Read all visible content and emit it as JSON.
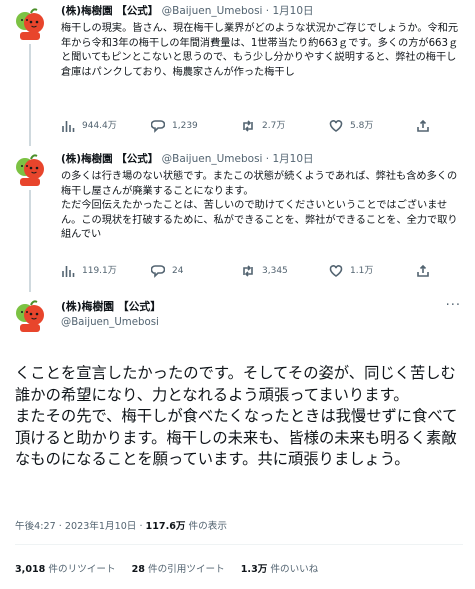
{
  "account": {
    "name": "(株)梅樹園 【公式】",
    "handle": "@Baijuen_Umebosi"
  },
  "tweets": [
    {
      "name": "(株)梅樹園 【公式】",
      "handle_date": "@Baijuen_Umebosi · 1月10日",
      "text": "梅干しの現実。皆さん、現在梅干し業界がどのような状況かご存じでしょうか。令和元年から令和3年の梅干しの年間消費量は、1世帯当たり約663ｇです。多くの方が663ｇと聞いてもピンとこないと思うので、もう少し分かりやすく説明すると、弊社の梅干し倉庫はパンクしており、梅農家さんが作った梅干し",
      "views": "944.4万",
      "replies": "1,239",
      "retweets": "2.7万",
      "likes": "5.8万"
    },
    {
      "name": "(株)梅樹園 【公式】",
      "handle_date": "@Baijuen_Umebosi · 1月10日",
      "text": "の多くは行き場のない状態です。またこの状態が続くようであれば、弊社も含め多くの梅干し屋さんが廃業することになります。\nただ今回伝えたかったことは、苦しいので助けてくださいということではございません。この現状を打破するために、私ができることを、弊社ができることを、全力で取り組んでい",
      "views": "119.1万",
      "replies": "24",
      "retweets": "3,345",
      "likes": "1.1万"
    }
  ],
  "main_tweet": {
    "text": "くことを宣言したかったのです。そしてその姿が、同じく苦しむ誰かの希望になり、力となれるよう頑張ってまいります。\nまたその先で、梅干しが食べたくなったときは我慢せずに食べて頂けると助かります。梅干しの未来も、皆様の未来も明るく素敵なものになることを願っています。共に頑張りましょう。",
    "time": "午後4:27 · 2023年1月10日 · ",
    "views_count": "117.6万",
    "views_label": " 件の表示",
    "retweets_count": "3,018",
    "retweets_label": " 件のリツイート",
    "quotes_count": "28",
    "quotes_label": " 件の引用ツイート",
    "likes_count": "1.3万",
    "likes_label": " 件のいいね"
  },
  "more_menu": "···",
  "icons": [
    "views-icon",
    "reply-icon",
    "retweet-icon",
    "like-icon"
  ],
  "colors": {
    "text": "#0f1419",
    "muted": "#536471",
    "line": "#cfd9de",
    "avatar_red": "#e8452c",
    "avatar_green": "#7cc243"
  }
}
